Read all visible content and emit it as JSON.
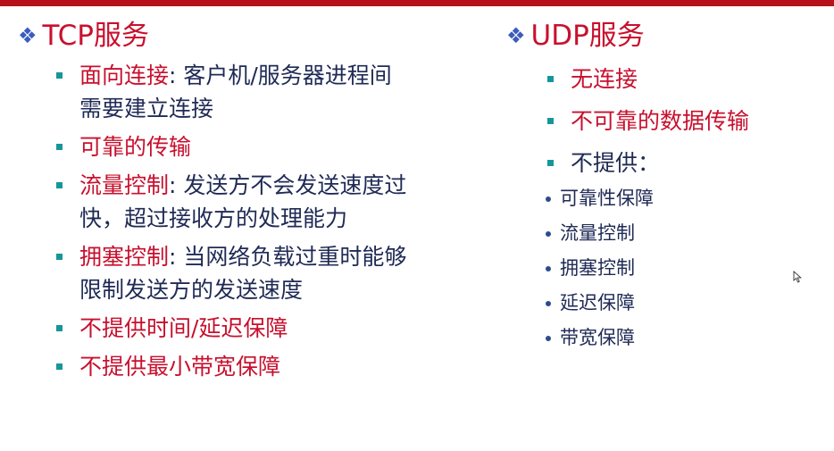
{
  "tcp": {
    "title": "TCP服务",
    "items": [
      {
        "head": "面向连接",
        "rest": ": 客户机/服务器进程间",
        "cont": "需要建立连接"
      },
      {
        "head": "可靠的传输",
        "rest": "",
        "cont": ""
      },
      {
        "head": "流量控制",
        "rest": ": 发送方不会发送速度过",
        "cont": "快，超过接收方的处理能力"
      },
      {
        "head": "拥塞控制",
        "rest": ": 当网络负载过重时能够",
        "cont": "限制发送方的发送速度"
      },
      {
        "head": "不提供时间/延迟保障",
        "rest": "",
        "cont": ""
      },
      {
        "head": "不提供最小带宽保障",
        "rest": "",
        "cont": ""
      }
    ]
  },
  "udp": {
    "title": "UDP服务",
    "items": [
      "无连接",
      "不可靠的数据传输",
      "不提供："
    ],
    "subitems": [
      "可靠性保障",
      "流量控制",
      "拥塞控制",
      "延迟保障",
      "带宽保障"
    ]
  },
  "colors": {
    "accent_red": "#c8102e",
    "text_navy": "#1f2a55",
    "bullet_teal": "#17969a",
    "diamond_blue": "#3b5bbf",
    "top_bar": "#b5121b"
  },
  "icons": {
    "heading_bullet": "diamond-cluster-icon",
    "cursor": "mouse-pointer-icon"
  }
}
